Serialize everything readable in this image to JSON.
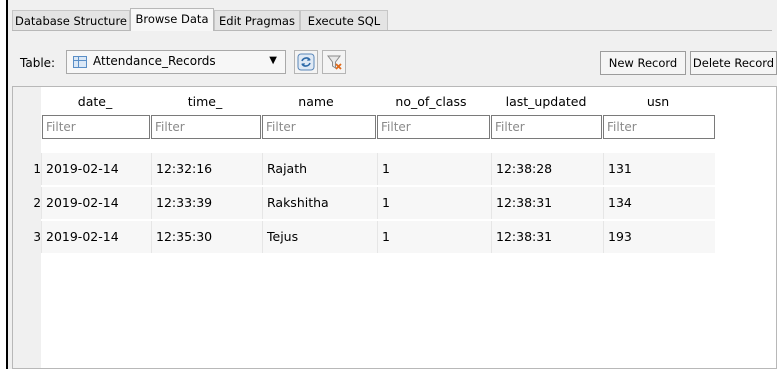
{
  "tabs": [
    {
      "label": "Database Structure",
      "active": false
    },
    {
      "label": "Browse Data",
      "active": true
    },
    {
      "label": "Edit Pragmas",
      "active": false
    },
    {
      "label": "Execute SQL",
      "active": false
    }
  ],
  "toolbar": {
    "table_label": "Table:",
    "table_value": "Attendance_Records",
    "refresh_icon": "refresh-icon",
    "clear_filter_icon": "clear-filter-icon",
    "new_record_label": "New Record",
    "delete_record_label": "Delete Record"
  },
  "grid": {
    "columns": [
      "date_",
      "time_",
      "name",
      "no_of_class",
      "last_updated",
      "usn"
    ],
    "filter_placeholder": "Filter",
    "rows": [
      {
        "num": "1",
        "cells": [
          "2019-02-14",
          "12:32:16",
          "Rajath",
          "1",
          "12:38:28",
          "131"
        ]
      },
      {
        "num": "2",
        "cells": [
          "2019-02-14",
          "12:33:39",
          "Rakshitha",
          "1",
          "12:38:31",
          "134"
        ]
      },
      {
        "num": "3",
        "cells": [
          "2019-02-14",
          "12:35:30",
          "Tejus",
          "1",
          "12:38:31",
          "193"
        ]
      }
    ]
  },
  "colors": {
    "row_bg": "#f7f7f7",
    "frame_bg": "#f0f0f0"
  }
}
